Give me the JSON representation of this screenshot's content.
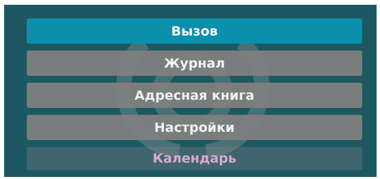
{
  "menu": {
    "items": [
      {
        "label": "Вызов"
      },
      {
        "label": "Журнал"
      },
      {
        "label": "Адресная книга"
      },
      {
        "label": "Настройки"
      },
      {
        "label": "Календарь"
      }
    ],
    "active_index": 0
  },
  "colors": {
    "background": "#1d5862",
    "active_item": "#0a8fad",
    "item": "#808080",
    "text": "#f2f2f2",
    "faded_text": "#d9a9d2"
  },
  "icons": {
    "background": "watermark-logo-icon"
  }
}
